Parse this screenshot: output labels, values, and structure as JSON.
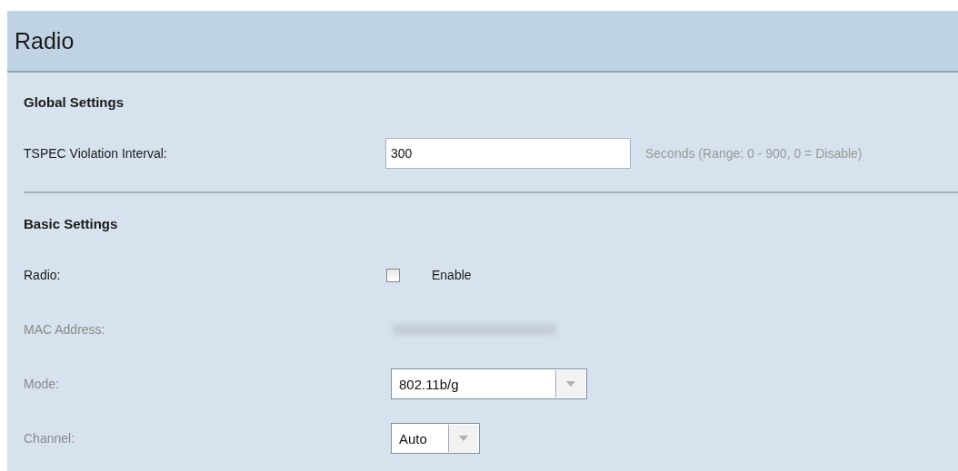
{
  "page": {
    "title": "Radio"
  },
  "sections": [
    {
      "heading": "Global Settings",
      "rows": [
        {
          "kind": "text",
          "label": "TSPEC Violation Interval:",
          "disabled": false,
          "value": "300",
          "hint": "Seconds (Range: 0 - 900, 0 = Disable)"
        }
      ]
    },
    {
      "heading": "Basic Settings",
      "rows": [
        {
          "kind": "checkbox",
          "label": "Radio:",
          "disabled": false,
          "checked": false,
          "option": "Enable"
        },
        {
          "kind": "redacted",
          "label": "MAC Address:",
          "disabled": true
        },
        {
          "kind": "select",
          "label": "Mode:",
          "disabled": true,
          "value": "802.11b/g"
        },
        {
          "kind": "short-select",
          "label": "Channel:",
          "disabled": true,
          "value": "Auto"
        }
      ]
    }
  ]
}
